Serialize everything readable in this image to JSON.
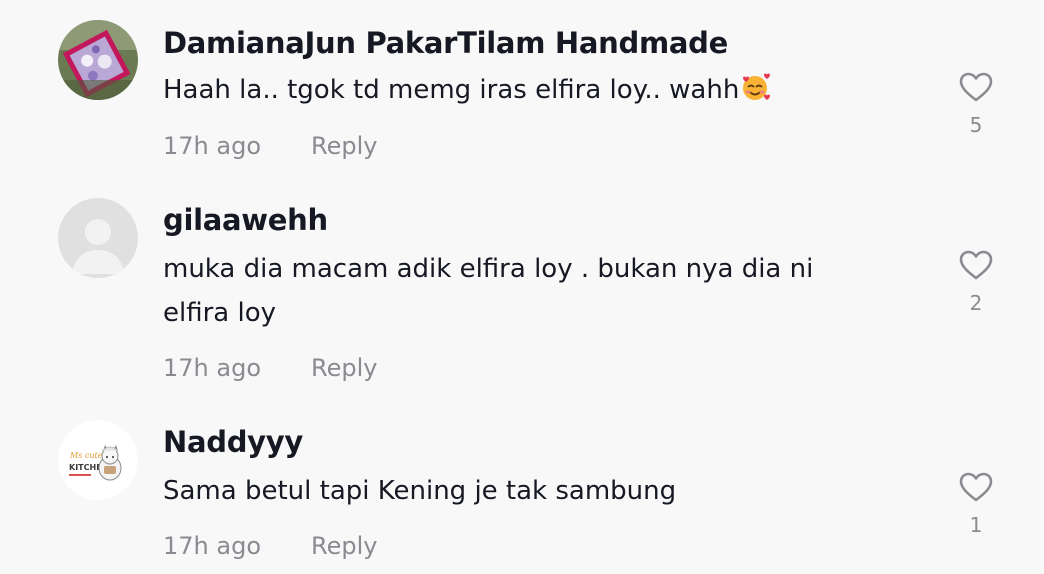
{
  "comments": [
    {
      "username": "DamianaJun PakarTilam Handmade",
      "text": "Haah la.. tgok td memg iras elfira loy.. wahh",
      "emoji": "smiling-face-with-hearts",
      "time": "17h ago",
      "reply_label": "Reply",
      "likes": "5",
      "avatar": "photo-avatar"
    },
    {
      "username": "gilaawehh",
      "text_lines": [
        "muka dia macam adik elfira loy . bukan nya dia ni",
        "elfira loy"
      ],
      "time": "17h ago",
      "reply_label": "Reply",
      "likes": "2",
      "avatar": "default-avatar"
    },
    {
      "username": "Naddyyy",
      "text": "Sama betul tapi Kening je tak sambung",
      "time": "17h ago",
      "reply_label": "Reply",
      "likes": "1",
      "avatar": "kitchen-logo-avatar",
      "avatar_logo": {
        "script_text": "Ms cute",
        "word": "KITCHEN"
      }
    }
  ],
  "colors": {
    "background": "#f8f8f8",
    "primary_text": "#161823",
    "secondary_text": "#8a8b91"
  }
}
